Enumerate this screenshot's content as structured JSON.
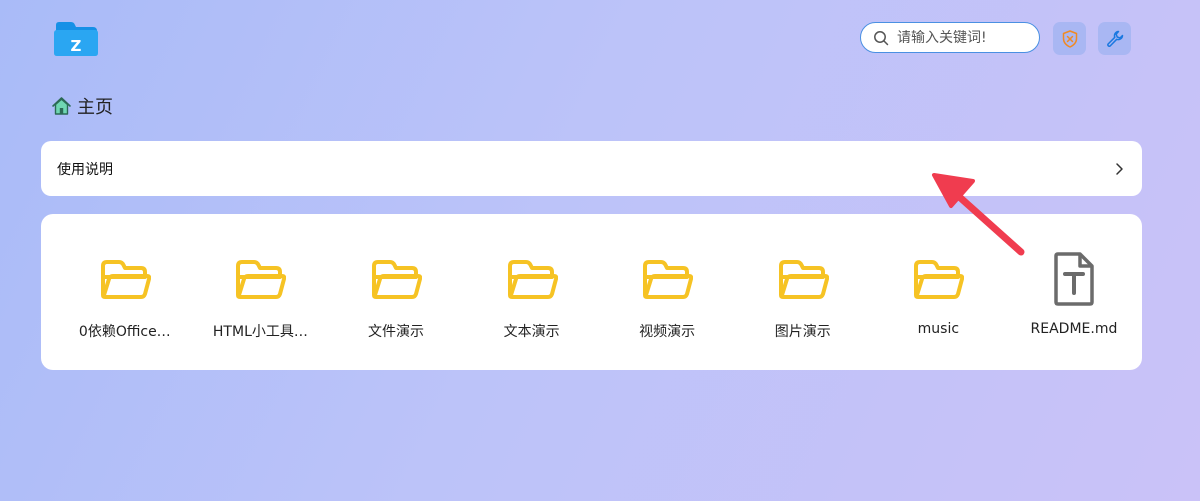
{
  "header": {
    "logo_letter": "Z",
    "search": {
      "placeholder": "请输入关键词!"
    },
    "icons": [
      "search-icon",
      "shield-icon",
      "wrench-icon"
    ]
  },
  "breadcrumb": {
    "home_label": "主页"
  },
  "instructions": {
    "label": "使用说明"
  },
  "files": [
    {
      "name": "0依赖Office…",
      "type": "folder"
    },
    {
      "name": "HTML小工具…",
      "type": "folder"
    },
    {
      "name": "文件演示",
      "type": "folder"
    },
    {
      "name": "文本演示",
      "type": "folder"
    },
    {
      "name": "视频演示",
      "type": "folder"
    },
    {
      "name": "图片演示",
      "type": "folder"
    },
    {
      "name": "music",
      "type": "folder"
    },
    {
      "name": "README.md",
      "type": "text-file"
    }
  ],
  "colors": {
    "accent": "#4a90e2",
    "folder": "#f6c324",
    "annotation_arrow": "#f03c4f",
    "text_file_icon": "#6b6b6b"
  }
}
